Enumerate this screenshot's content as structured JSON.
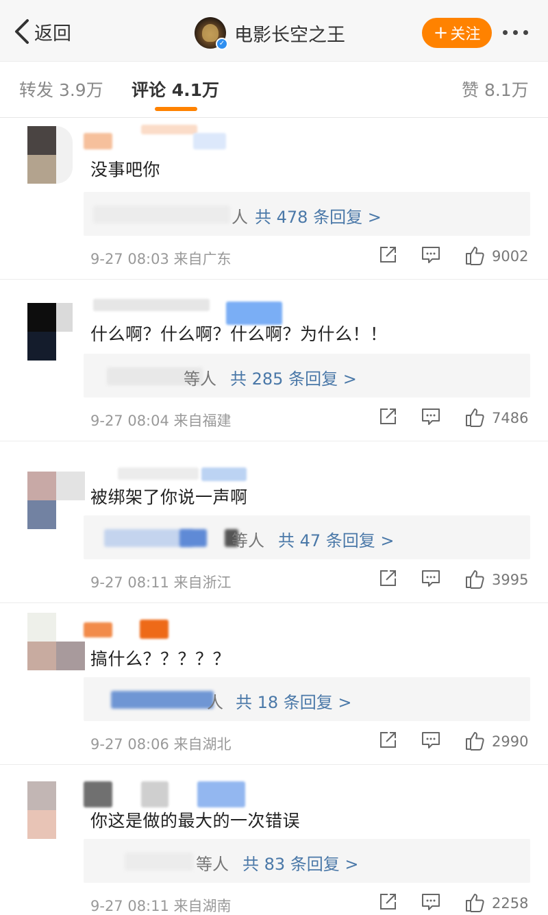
{
  "header": {
    "back_label": "返回",
    "account_name": "电影长空之王",
    "follow_label": "关注",
    "verified": true
  },
  "tabs": [
    {
      "label": "转发 3.9万",
      "active": false
    },
    {
      "label": "评论 4.1万",
      "active": true
    },
    {
      "label": "赞 8.1万",
      "active": false
    }
  ],
  "comments": [
    {
      "text": "没事吧你",
      "reply_who": "人",
      "reply_count": "共 478 条回复 >",
      "time": "9-27 08:03",
      "location": "来自广东",
      "likes": "9002"
    },
    {
      "text": "什么啊？什么啊？什么啊？为什么！！",
      "reply_who": "等人",
      "reply_count": "共 285 条回复 >",
      "time": "9-27 08:04",
      "location": "来自福建",
      "likes": "7486"
    },
    {
      "text": "被绑架了你说一声啊",
      "reply_who": "等人",
      "reply_count": "共 47 条回复 >",
      "time": "9-27 08:11",
      "location": "来自浙江",
      "likes": "3995"
    },
    {
      "text": "搞什么？？？？？",
      "reply_who": "人",
      "reply_count": "共 18 条回复 >",
      "time": "9-27 08:06",
      "location": "来自湖北",
      "likes": "2990"
    },
    {
      "text": "你这是做的最大的一次错误",
      "reply_who": "等人",
      "reply_count": "共 83 条回复 >",
      "time": "9-27 08:11",
      "location": "来自湖南",
      "likes": "2258"
    }
  ],
  "colors": {
    "accent": "#ff8200",
    "link": "#4a78a8",
    "header_bg": "#f7f7f7"
  },
  "icons": [
    "chevron-left-icon",
    "verified-icon",
    "more-icon",
    "share-icon",
    "comment-icon",
    "like-icon"
  ]
}
